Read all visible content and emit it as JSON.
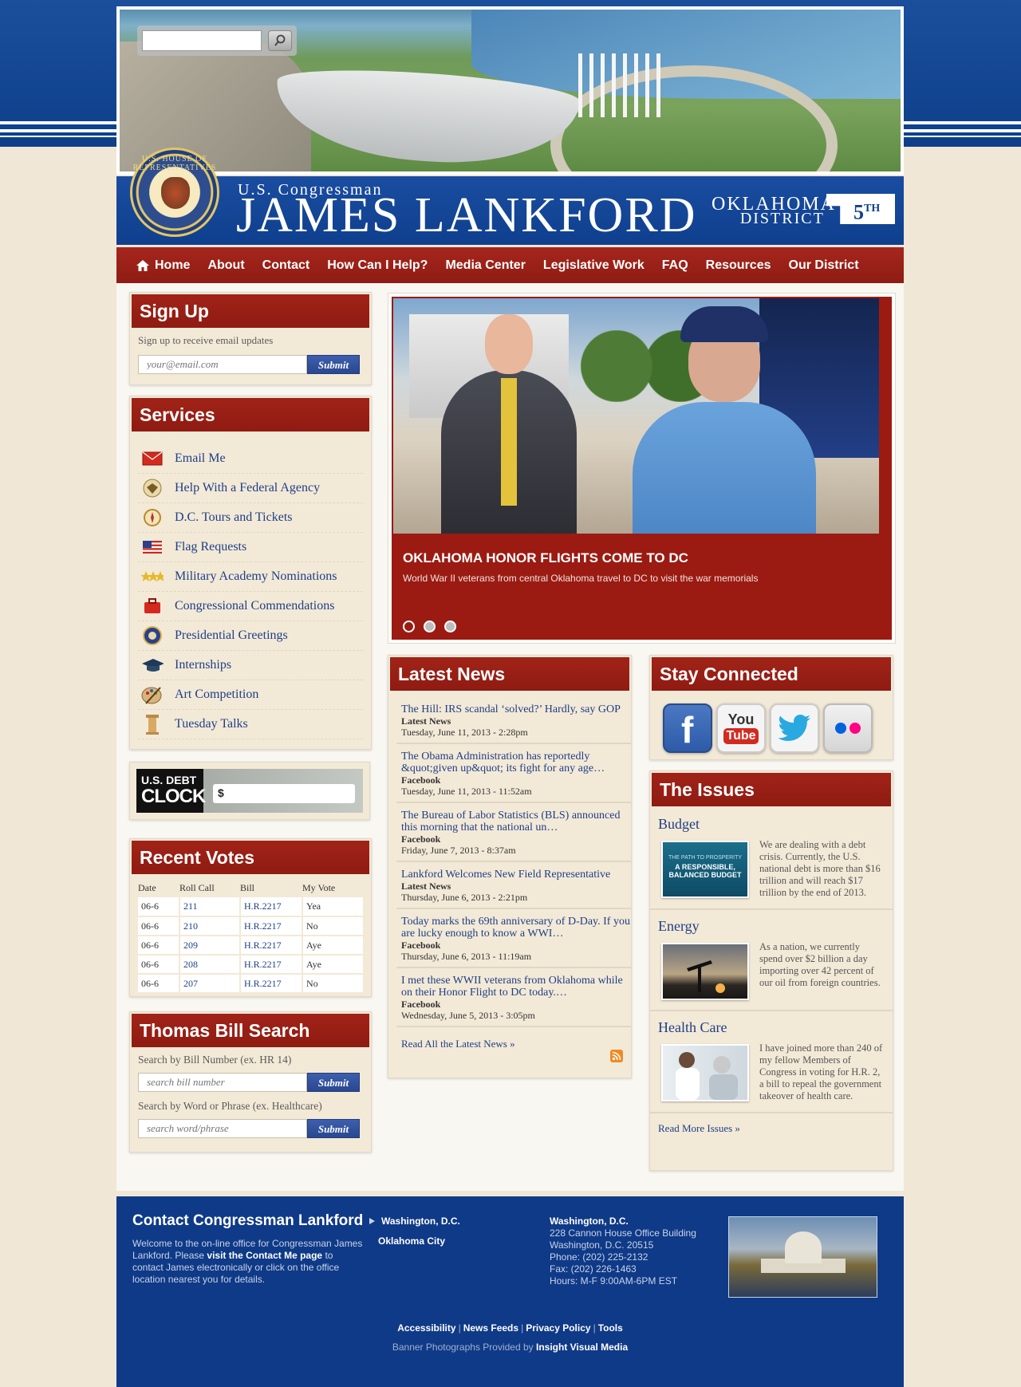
{
  "search": {
    "placeholder": ""
  },
  "header": {
    "seal_text": "U.S. HOUSE OF REPRESENTATIVES",
    "title_small": "U.S. Congressman",
    "title_big": "JAMES LANKFORD",
    "district_line1": "OKLAHOMA'S",
    "district_line2": "DISTRICT",
    "district_num": "5",
    "district_suffix": "TH"
  },
  "nav": {
    "items": [
      "Home",
      "About",
      "Contact",
      "How Can I Help?",
      "Media Center",
      "Legislative Work",
      "FAQ",
      "Resources",
      "Our District"
    ]
  },
  "signup": {
    "title": "Sign Up",
    "text": "Sign up to receive email updates",
    "placeholder": "your@email.com",
    "button": "Submit"
  },
  "services": {
    "title": "Services",
    "items": [
      {
        "label": "Email Me",
        "icon": "envelope-icon"
      },
      {
        "label": "Help With a Federal Agency",
        "icon": "federal-seal-icon"
      },
      {
        "label": "D.C. Tours and Tickets",
        "icon": "compass-icon"
      },
      {
        "label": "Flag Requests",
        "icon": "flag-icon"
      },
      {
        "label": "Military Academy Nominations",
        "icon": "stars-icon"
      },
      {
        "label": "Congressional Commendations",
        "icon": "briefcase-icon"
      },
      {
        "label": "Presidential Greetings",
        "icon": "presidential-seal-icon"
      },
      {
        "label": "Internships",
        "icon": "graduation-cap-icon"
      },
      {
        "label": "Art Competition",
        "icon": "palette-icon"
      },
      {
        "label": "Tuesday Talks",
        "icon": "column-icon"
      }
    ]
  },
  "debt_clock": {
    "label_small": "U.S. DEBT",
    "label_big": "CLOCK",
    "value": "$"
  },
  "votes": {
    "title": "Recent Votes",
    "headers": [
      "Date",
      "Roll Call",
      "Bill",
      "My Vote"
    ],
    "rows": [
      [
        "06-6",
        "211",
        "H.R.2217",
        "Yea"
      ],
      [
        "06-6",
        "210",
        "H.R.2217",
        "No"
      ],
      [
        "06-6",
        "209",
        "H.R.2217",
        "Aye"
      ],
      [
        "06-6",
        "208",
        "H.R.2217",
        "Aye"
      ],
      [
        "06-6",
        "207",
        "H.R.2217",
        "No"
      ]
    ]
  },
  "bill_search": {
    "title": "Thomas Bill Search",
    "label1": "Search by Bill Number (ex. HR 14)",
    "placeholder1": "search bill number",
    "label2": "Search by Word or Phrase (ex. Healthcare)",
    "placeholder2": "search word/phrase",
    "button": "Submit"
  },
  "slider": {
    "title": "OKLAHOMA HONOR FLIGHTS COME TO DC",
    "desc": "World War II veterans from central Oklahoma travel to DC to visit the war memorials",
    "active_index": 0,
    "count": 3
  },
  "news": {
    "title": "Latest News",
    "items": [
      {
        "title": "The Hill: IRS scandal ‘solved?’ Hardly, say GOP",
        "source": "Latest News",
        "date": "Tuesday, June 11, 2013 - 2:28pm"
      },
      {
        "title": "The Obama Administration has reportedly &quot;given up&quot; its fight for any age…",
        "source": "Facebook",
        "date": "Tuesday, June 11, 2013 - 11:52am"
      },
      {
        "title": "The Bureau of Labor Statistics (BLS) announced this morning that the national un…",
        "source": "Facebook",
        "date": "Friday, June 7, 2013 - 8:37am"
      },
      {
        "title": "Lankford Welcomes New Field Representative",
        "source": "Latest News",
        "date": "Thursday, June 6, 2013 - 2:21pm"
      },
      {
        "title": "Today marks the 69th anniversary of D-Day. If you are lucky enough to know a WWI…",
        "source": "Facebook",
        "date": "Thursday, June 6, 2013 - 11:19am"
      },
      {
        "title": "I met these WWII veterans from Oklahoma while on their Honor Flight to DC today.…",
        "source": "Facebook",
        "date": "Wednesday, June 5, 2013 - 3:05pm"
      }
    ],
    "read_all": "Read All the Latest News »"
  },
  "social": {
    "title": "Stay Connected",
    "items": [
      "facebook-icon",
      "youtube-icon",
      "twitter-icon",
      "flickr-icon"
    ],
    "youtube_label1": "You",
    "youtube_label2": "Tube"
  },
  "issues": {
    "title": "The Issues",
    "items": [
      {
        "title": "Budget",
        "text": "We are dealing with a debt crisis. Currently, the U.S. national debt is more than $16 trillion and will reach $17 trillion by the end of 2013.",
        "img_line1": "THE PATH TO PROSPERITY",
        "img_line2": "A RESPONSIBLE, BALANCED BUDGET"
      },
      {
        "title": "Energy",
        "text": "As a nation, we currently spend over $2 billion a day importing over 42 percent of our oil from foreign countries."
      },
      {
        "title": "Health Care",
        "text": "I have joined more than 240 of my fellow Members of Congress in voting for H.R. 2, a bill to repeal the government takeover of health care."
      }
    ],
    "read_more": "Read More Issues »"
  },
  "footer": {
    "title": "Contact Congressman Lankford",
    "desc_before": "Welcome to the on-line office for Congressman James Lankford. Please ",
    "desc_link": "visit the Contact Me page",
    "desc_after": " to contact James electronically or click on the office location nearest you for details.",
    "offices": [
      "Washington, D.C.",
      "Oklahoma City"
    ],
    "address": {
      "heading": "Washington, D.C.",
      "line1": "228 Cannon House Office Building",
      "line2": "Washington, D.C. 20515",
      "phone": "Phone: (202) 225-2132",
      "fax": "Fax: (202) 226-1463",
      "hours": "Hours: M-F 9:00AM-6PM EST"
    },
    "links": [
      "Accessibility",
      "News Feeds",
      "Privacy Policy",
      "Tools"
    ],
    "credit_prefix": "Banner Photographs Provided by ",
    "credit_name": "Insight Visual Media"
  },
  "colors": {
    "primary_blue": "#0f3f8e",
    "accent_red": "#9b1b12",
    "background": "#f1e7d6",
    "link": "#1e3f86"
  }
}
